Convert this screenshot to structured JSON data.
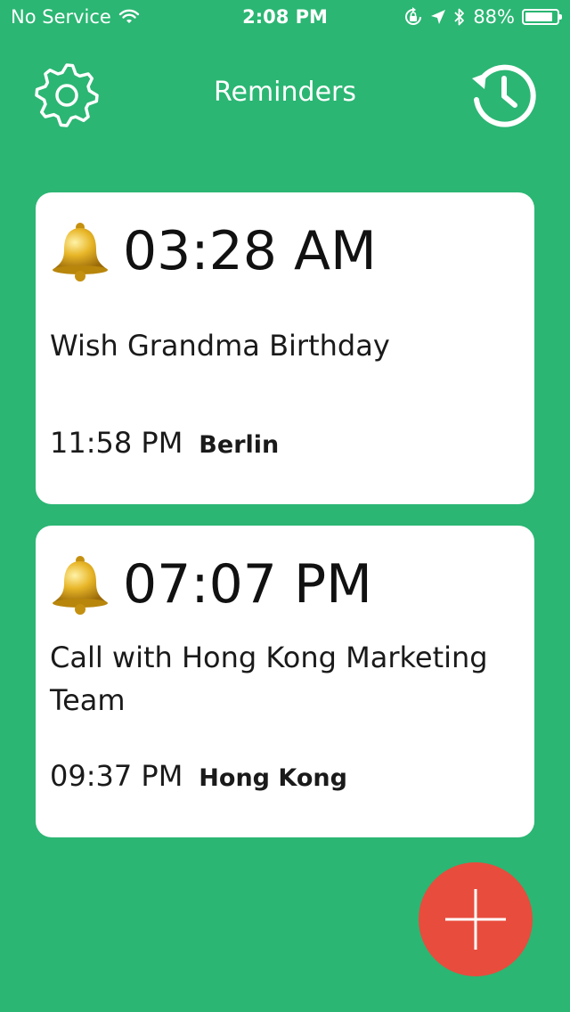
{
  "status_bar": {
    "carrier": "No Service",
    "time": "2:08 PM",
    "battery_percent": "88%",
    "battery_level": 0.88
  },
  "nav": {
    "title": "Reminders",
    "settings_icon": "gear-icon",
    "history_icon": "history-icon"
  },
  "reminders": [
    {
      "time": "03:28 AM",
      "title": "Wish Grandma Birthday",
      "local_time": "11:58 PM",
      "city": "Berlin"
    },
    {
      "time": "07:07 PM",
      "title": "Call with Hong Kong Marketing Team",
      "local_time": "09:37 PM",
      "city": "Hong Kong"
    }
  ],
  "fab": {
    "icon": "plus-icon"
  },
  "colors": {
    "background": "#2bb673",
    "card": "#ffffff",
    "fab": "#e84c3d"
  }
}
